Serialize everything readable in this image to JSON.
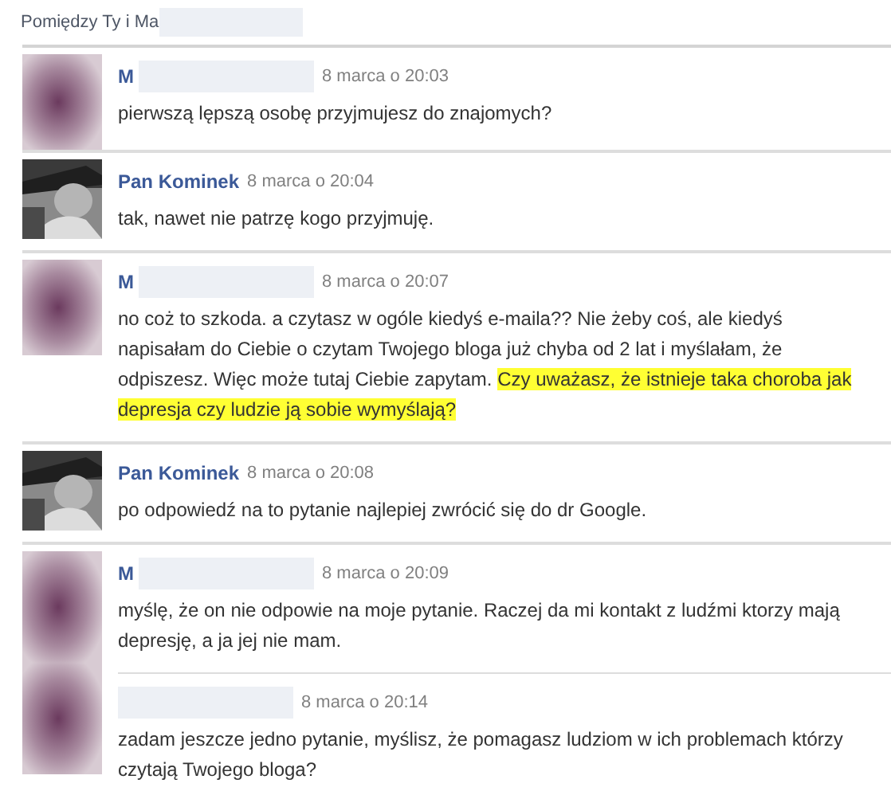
{
  "header": {
    "label": "Pomiędzy Ty i Ma",
    "redacted": true
  },
  "groups": [
    {
      "kind": "blurred",
      "messages": [
        {
          "name": "M",
          "redacted": true,
          "time": "8 marca o 20:03",
          "text": "pierwszą lępszą osobę przyjmujesz do znajomych?"
        }
      ]
    },
    {
      "messages": [
        {
          "name": "Pan Kominek",
          "redacted": false,
          "time": "8 marca o 20:04",
          "text": "tak, nawet nie patrzę kogo przyjmuję."
        }
      ]
    },
    {
      "kind": "blurred",
      "messages": [
        {
          "name": "M",
          "redacted": true,
          "time": "8 marca o 20:07",
          "text": "no coż to szkoda. a czytasz w ogóle kiedyś e-maila?? Nie żeby coś, ale kiedyś napisałam do Ciebie o czytam Twojego bloga już chyba od 2 lat i myślałam, że odpiszesz. Więc może tutaj Ciebie zapytam. ",
          "highlight": "Czy uważasz, że istnieje taka choroba jak depresja czy ludzie ją sobie wymyślają?"
        }
      ]
    },
    {
      "messages": [
        {
          "name": "Pan Kominek",
          "redacted": false,
          "time": "8 marca o 20:08",
          "text": "po odpowiedź na to pytanie najlepiej zwrócić się do dr Google."
        }
      ]
    },
    {
      "kind": "blurred-tall",
      "messages": [
        {
          "name": "M",
          "redacted": true,
          "time": "8 marca o 20:09",
          "text": "myślę, że on nie odpowie na moje pytanie. Raczej da mi kontakt z ludźmi ktorzy mają depresję, a ja jej nie mam."
        },
        {
          "redacted": true,
          "time": "8 marca o 20:14",
          "text": "zadam jeszcze jedno pytanie, myślisz, że pomagasz ludziom w ich problemach którzy czytają Twojego bloga?"
        }
      ]
    }
  ]
}
